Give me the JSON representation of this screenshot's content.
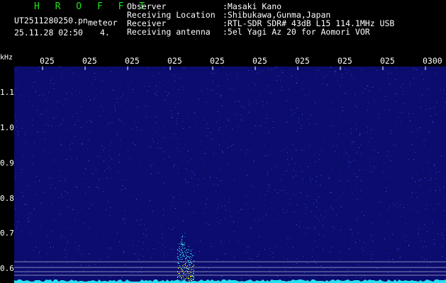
{
  "header": {
    "brand": "H R O F F T",
    "filename": "UT2511280250.pn",
    "label": "meteor",
    "datetime": "25.11.28 02:50",
    "count": "4.",
    "fields": [
      {
        "key": "Observer",
        "value": ":Masaki Kano"
      },
      {
        "key": "Receiving Location",
        "value": ":Shibukawa,Gunma,Japan"
      },
      {
        "key": "Receiver",
        "value": ":RTL-SDR SDR# 43dB L15 114.1MHz USB"
      },
      {
        "key": "Receiving antenna",
        "value": ":5el Yagi Az 20 for Aomori VOR"
      }
    ]
  },
  "axis": {
    "unit": "kHz",
    "x_ticks": [
      "025",
      "025",
      "025",
      "025",
      "025",
      "025",
      "025",
      "025",
      "025",
      "0300"
    ],
    "y_ticks": [
      "1.1",
      "1.0",
      "0.9",
      "0.8",
      "0.7",
      "0.6"
    ]
  },
  "colors": {
    "background": "#0c0c6e",
    "noise": "#3a5cff",
    "echo_core": "#e6f010",
    "echo_edge": "#30d0e0",
    "baseline": "#26e0f0",
    "guide_lines": "#b0b0d0"
  }
}
